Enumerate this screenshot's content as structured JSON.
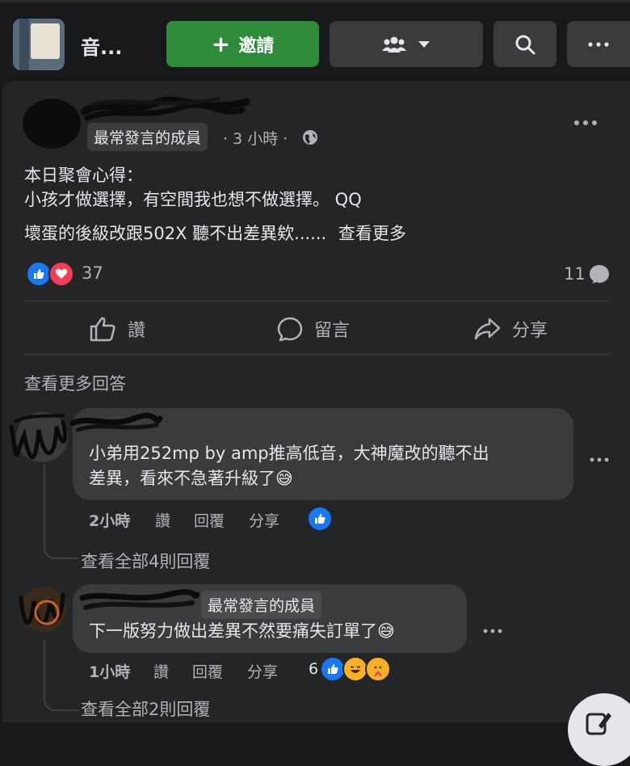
{
  "header": {
    "group_name": "音...",
    "invite_label": "邀請",
    "invite_icon": "plus-icon",
    "members_icon": "people-icon",
    "members_dropdown_icon": "caret-down-icon",
    "search_icon": "search-icon",
    "more_icon": "more-dots-icon"
  },
  "post": {
    "author_badge": "最常發言的成員",
    "time": "3 小時",
    "privacy_icon": "globe-icon",
    "text_line1": "本日聚會心得：",
    "text_line2": "小孩才做選擇，有空間我也想不做選擇。 QQ",
    "text_line3": "壞蛋的後級改跟502X 聽不出差異欸......",
    "see_more": "查看更多",
    "reaction_count": "37",
    "comment_count": "11",
    "actions": {
      "like": "讚",
      "comment": "留言",
      "share": "分享"
    }
  },
  "comments": {
    "see_more_answers": "查看更多回答",
    "items": [
      {
        "text_line1": "小弟用252mp by amp推高低音，大神魔改的聽不出",
        "text_line2": "差異，看來不急著升級了😅",
        "time": "2小時",
        "like": "讚",
        "reply": "回覆",
        "share": "分享",
        "view_replies": "查看全部4則回覆"
      },
      {
        "badge": "最常發言的成員",
        "text_line1": "下一版努力做出差異不然要痛失訂單了😅",
        "time": "1小時",
        "like": "讚",
        "reply": "回覆",
        "share": "分享",
        "reaction_count": "6",
        "view_replies": "查看全部2則回覆"
      }
    ]
  },
  "colors": {
    "background": "#18191a",
    "card": "#242526",
    "bubble": "#3a3b3c",
    "invite_green": "#2e8b3a",
    "like_blue": "#1877f2",
    "love_red": "#f33e58",
    "text_primary": "#e4e6eb",
    "text_secondary": "#b0b3b8"
  }
}
